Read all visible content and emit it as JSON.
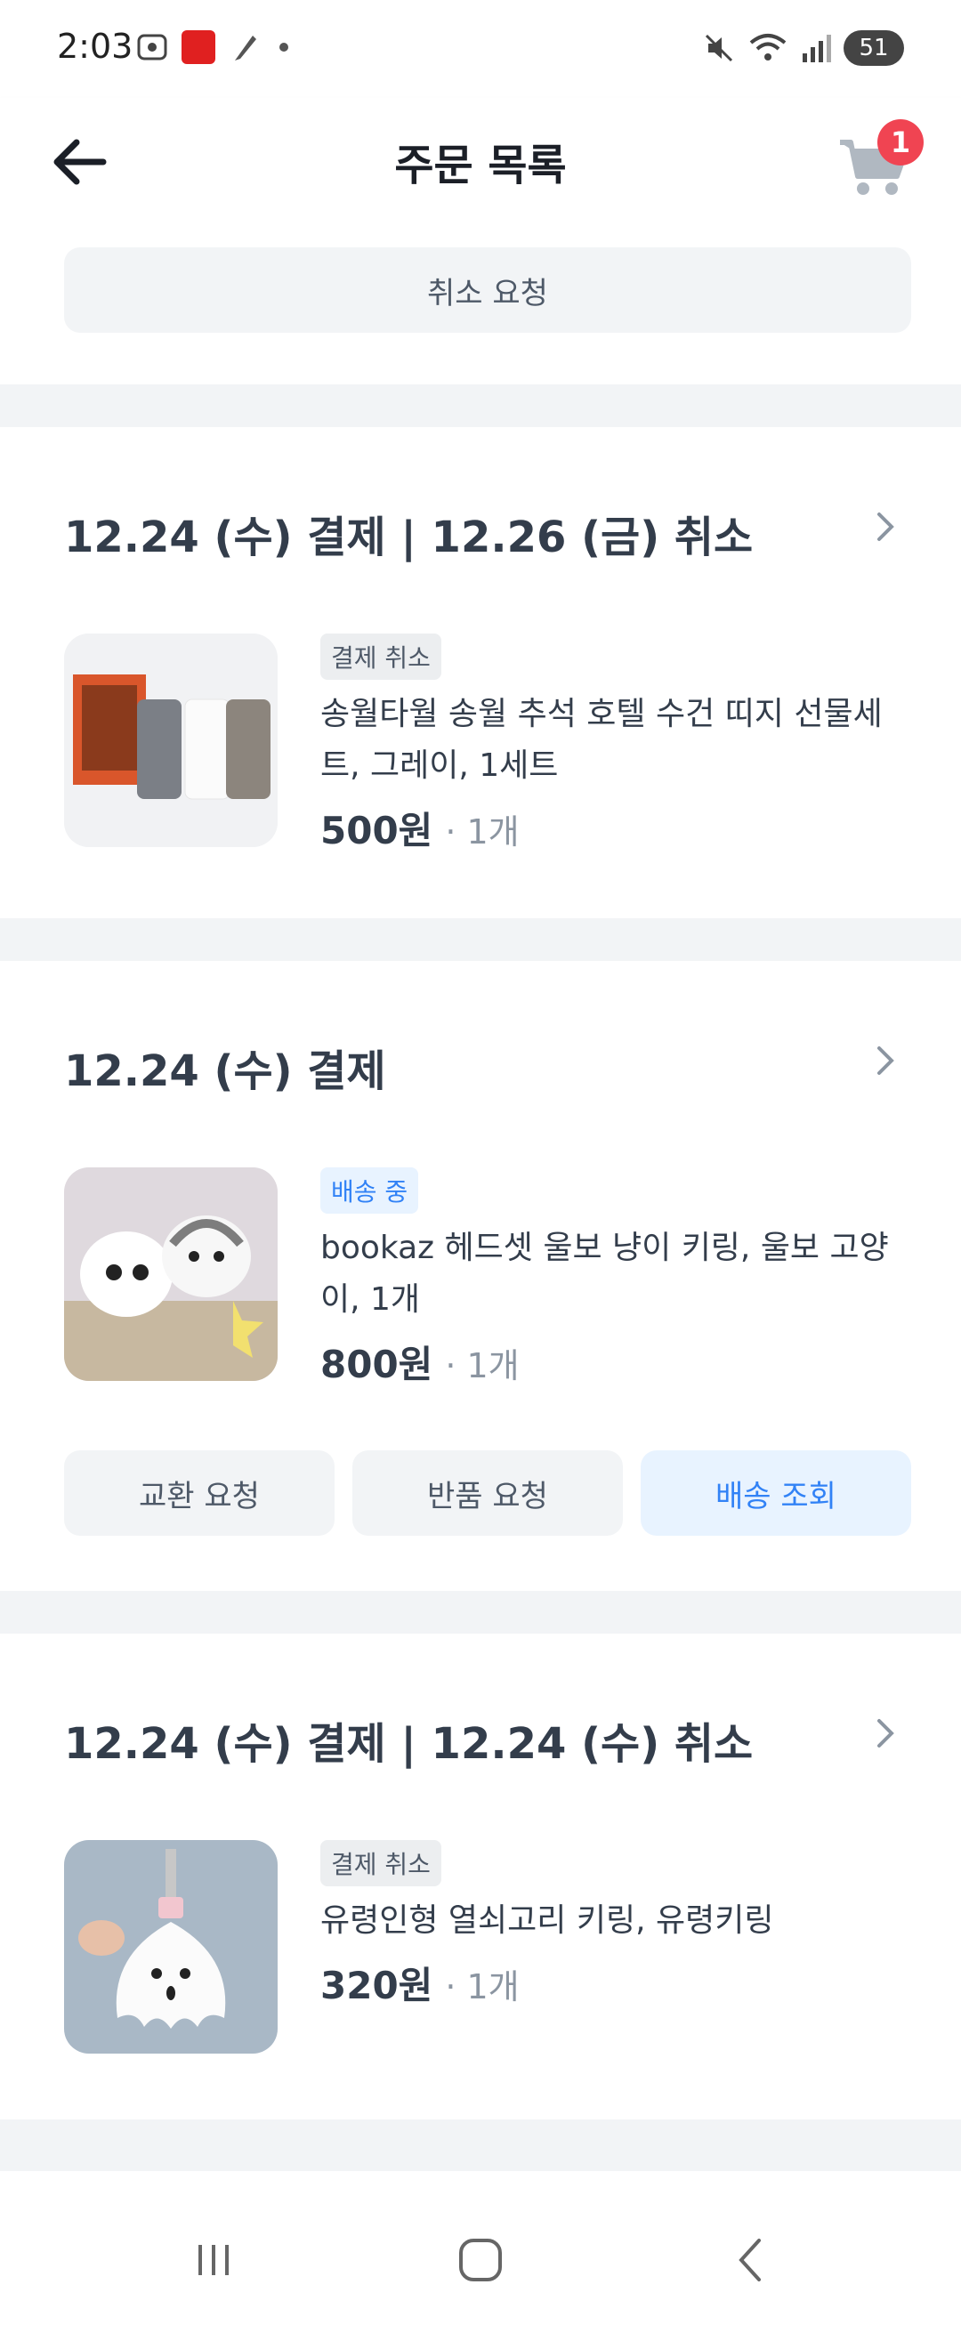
{
  "status_bar": {
    "time": "2:03",
    "battery": "51"
  },
  "app_bar": {
    "title": "주문 목록",
    "cart_count": "1"
  },
  "top_card": {
    "cancel_request_label": "취소 요청"
  },
  "orders": [
    {
      "header": "12.24 (수) 결제 | 12.26 (금) 취소",
      "status": "결제 취소",
      "product_name": "송월타월 송월 추석 호텔 수건 띠지 선물세트, 그레이, 1세트",
      "price": "500원",
      "qty": "· 1개"
    },
    {
      "header": "12.24 (수) 결제",
      "status": "배송 중",
      "product_name": "bookaz 헤드셋 울보 냥이 키링, 울보 고양이, 1개",
      "price": "800원",
      "qty": "· 1개",
      "actions": {
        "exchange": "교환 요청",
        "return": "반품 요청",
        "track": "배송 조회"
      }
    },
    {
      "header": "12.24 (수) 결제 | 12.24 (수) 취소",
      "status": "결제 취소",
      "product_name": "유령인형 열쇠고리 키링, 유령키링",
      "price": "320원",
      "qty": "· 1개"
    }
  ],
  "colors": {
    "accent_blue": "#3182f6",
    "badge_red": "#f04452",
    "text_dark": "#333d4b",
    "text_gray": "#8b95a1"
  }
}
